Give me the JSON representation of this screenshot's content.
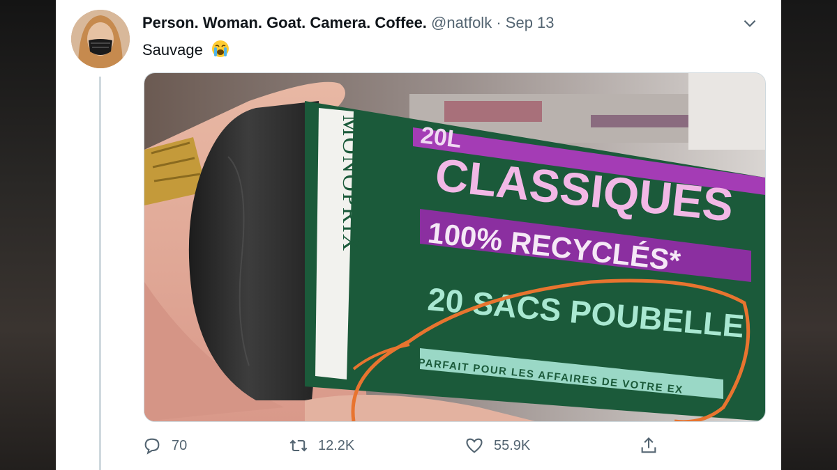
{
  "tweet": {
    "display_name": "Person. Woman. Goat. Camera. Coffee.",
    "handle": "@natfolk",
    "separator": "·",
    "date": "Sep 13",
    "text": "Sauvage",
    "emoji": "loudly-crying-face-icon"
  },
  "media": {
    "brand": "MONOPRIX",
    "top_partial": "20L",
    "line1": "CLASSIQUES",
    "line2": "100% RECYCLÉS*",
    "line3": "20 SACS POUBELLE",
    "line4": "PARFAIT POUR LES AFFAIRES DE VOTRE EX"
  },
  "actions": {
    "replies": "70",
    "retweets": "12.2K",
    "likes": "55.9K"
  },
  "colors": {
    "accent_orange": "#e8742f",
    "package_green": "#1b5a3a",
    "package_purple": "#8b2fa0",
    "text_secondary": "#536471"
  }
}
